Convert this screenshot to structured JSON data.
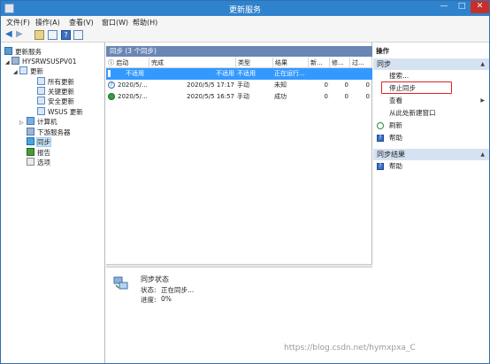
{
  "window": {
    "title": "更新服务",
    "minimize": "—",
    "maximize": "□",
    "close": "✕"
  },
  "menu": [
    "文件(F)",
    "操作(A)",
    "查看(V)",
    "窗口(W)",
    "帮助(H)"
  ],
  "toolbar": {
    "back_icon": "arrow-left-icon",
    "forward_icon": "arrow-right-icon",
    "help_label": "?"
  },
  "tree": {
    "root": "更新服务",
    "server": "HYSRWSUSPV01",
    "updates": "更新",
    "updates_children": [
      "所有更新",
      "关键更新",
      "安全更新",
      "WSUS 更新"
    ],
    "computers": "计算机",
    "downstream": "下游服务器",
    "sync": "同步",
    "reports": "报告",
    "options": "选项"
  },
  "center": {
    "header": "同步   (3 个同步)",
    "columns": [
      "启动",
      "完成",
      "类型",
      "结果",
      "新...",
      "修...",
      "过..."
    ],
    "rows": [
      {
        "start": "不适用",
        "end": "不适用",
        "type": "不适用",
        "result": "正在运行...",
        "new": "",
        "rev": "",
        "exp": "",
        "icon": "selected",
        "selected": true
      },
      {
        "start": "2020/5/...",
        "end": "2020/5/5 17:17",
        "type": "手动",
        "result": "未知",
        "new": "0",
        "rev": "0",
        "exp": "0",
        "icon": "question-icon",
        "selected": false
      },
      {
        "start": "2020/5/...",
        "end": "2020/5/5 16:57",
        "type": "手动",
        "result": "成功",
        "new": "0",
        "rev": "0",
        "exp": "0",
        "icon": "success-check-icon",
        "selected": false
      }
    ],
    "details": {
      "title": "同步状态",
      "status_label": "状态:",
      "status_value": "正在同步...",
      "progress_label": "进度:",
      "progress_value": "0%"
    }
  },
  "actions": {
    "header": "操作",
    "section1": "同步",
    "items1": [
      {
        "label": "搜索...",
        "icon": "search-icon"
      },
      {
        "label": "停止同步",
        "icon": "none"
      },
      {
        "label": "查看",
        "icon": "none",
        "submenu": true
      },
      {
        "label": "从此处新建窗口",
        "icon": "none"
      },
      {
        "label": "刷新",
        "icon": "refresh-icon"
      },
      {
        "label": "帮助",
        "icon": "help-icon"
      }
    ],
    "section2": "同步结果",
    "items2": [
      {
        "label": "帮助",
        "icon": "help-icon"
      }
    ]
  },
  "watermark": "https://blog.csdn.net/hymxpxa_C"
}
